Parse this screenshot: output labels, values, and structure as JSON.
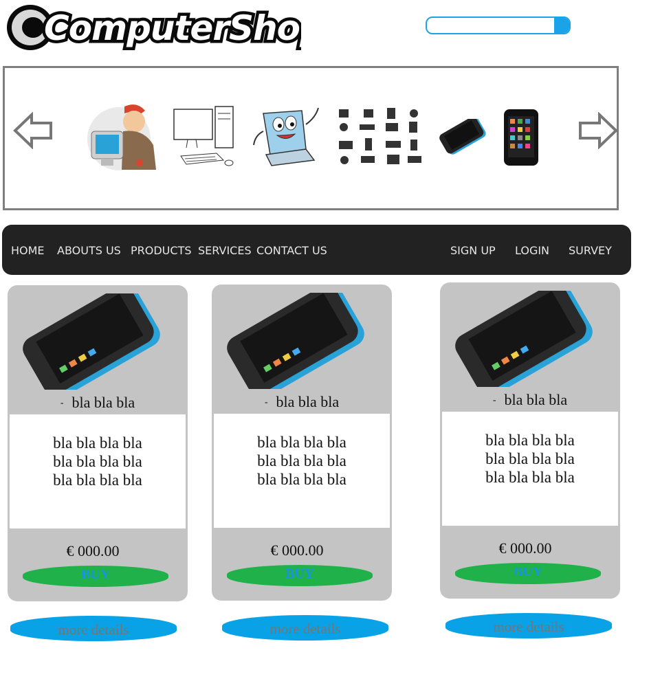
{
  "header": {
    "logo_text": "ComputerShop",
    "search": {
      "placeholder": "",
      "value": ""
    }
  },
  "carousel": {
    "prev_icon": "arrow-left-icon",
    "next_icon": "arrow-right-icon",
    "slides": [
      {
        "icon": "technician-icon"
      },
      {
        "icon": "desktop-computer-icon"
      },
      {
        "icon": "laptop-mascot-icon"
      },
      {
        "icon": "hardware-icons-grid-icon"
      },
      {
        "icon": "smartphone-icon"
      },
      {
        "icon": "tablet-icon"
      }
    ]
  },
  "nav": {
    "left": [
      "HOME",
      "ABOUTS US",
      "PRODUCTS",
      "SERVICES",
      "CONTACT US"
    ],
    "right": [
      "SIGN UP",
      "LOGIN",
      "SURVEY"
    ]
  },
  "products": [
    {
      "short": "bla bla bla",
      "desc_lines": [
        "bla bla bla bla",
        "bla bla bla bla",
        "bla bla bla bla"
      ],
      "price": "€ 000.00",
      "buy_label": "BUY",
      "more_label": "more details"
    },
    {
      "short": "bla bla bla",
      "desc_lines": [
        "bla bla bla bla",
        "bla bla bla bla",
        "bla bla bla bla"
      ],
      "price": "€ 000.00",
      "buy_label": "BUY",
      "more_label": "more details"
    },
    {
      "short": "bla bla bla",
      "desc_lines": [
        "bla bla bla bla",
        "bla bla bla bla",
        "bla bla bla bla"
      ],
      "price": "€ 000.00",
      "buy_label": "BUY",
      "more_label": "more details"
    }
  ],
  "colors": {
    "nav_bg": "#222222",
    "card_bg": "#c4c4c4",
    "buy_bg": "#21b14b",
    "more_bg": "#0aa2e6",
    "accent": "#1aa3e8"
  }
}
